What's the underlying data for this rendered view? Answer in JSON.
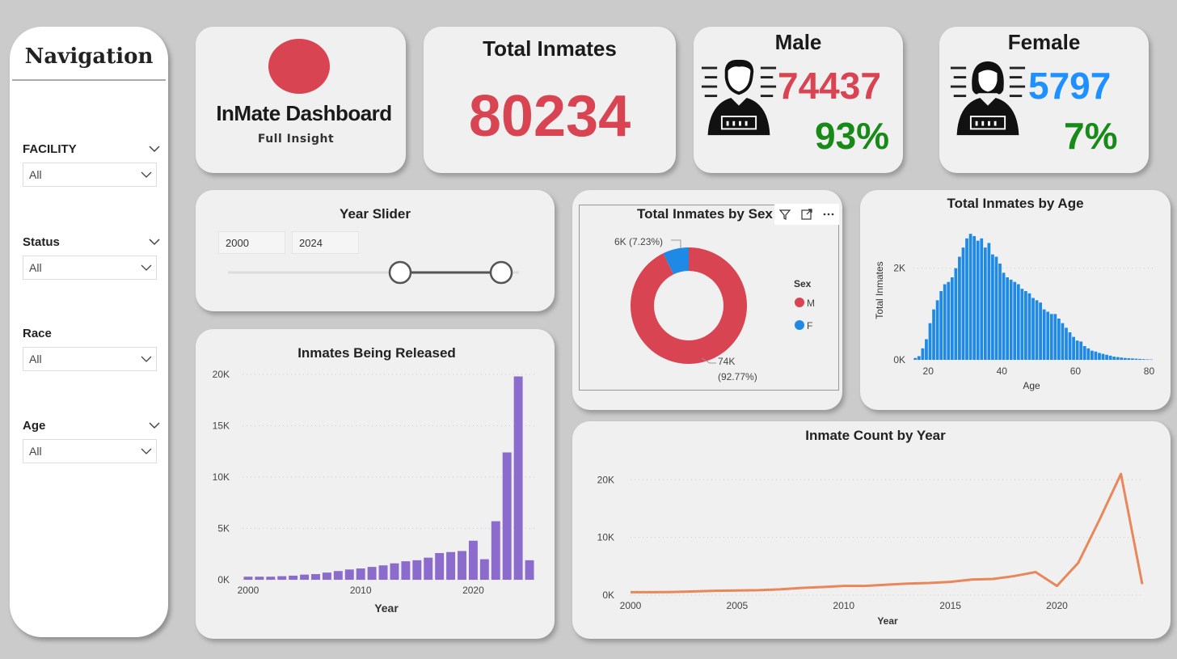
{
  "navigation": {
    "title": "Navigation",
    "filters": [
      {
        "label": "FACILITY",
        "value": "All"
      },
      {
        "label": "Status",
        "value": "All"
      },
      {
        "label": "Race",
        "value": "All"
      },
      {
        "label": "Age",
        "value": "All"
      }
    ]
  },
  "header": {
    "title": "InMate Dashboard",
    "subtitle": "Full Insight",
    "logo_color": "#d94452"
  },
  "kpis": {
    "total": {
      "label": "Total Inmates",
      "value": "80234"
    },
    "male": {
      "label": "Male",
      "value": "74437",
      "pct": "93%"
    },
    "female": {
      "label": "Female",
      "value": "5797",
      "pct": "7%"
    }
  },
  "colors": {
    "accent_red": "#d94452",
    "accent_blue": "#1e90ff",
    "pct_green": "#178a17",
    "released_bar": "#8b6bcc",
    "age_bar": "#1e8ae6",
    "line": "#e8875a"
  },
  "year_slider": {
    "title": "Year Slider",
    "start": "2000",
    "end": "2024",
    "start_level": 0.8,
    "end_level": 1.0
  },
  "chart_data": [
    {
      "id": "released",
      "type": "bar",
      "title": "Inmates Being Released",
      "xlabel": "Year",
      "ylabel": "",
      "ylim": [
        0,
        20000
      ],
      "yticks": [
        "0K",
        "5K",
        "10K",
        "15K",
        "20K"
      ],
      "xticks": [
        "2000",
        "2010",
        "2020"
      ],
      "categories": [
        2000,
        2001,
        2002,
        2003,
        2004,
        2005,
        2006,
        2007,
        2008,
        2009,
        2010,
        2011,
        2012,
        2013,
        2014,
        2015,
        2016,
        2017,
        2018,
        2019,
        2020,
        2021,
        2022,
        2023,
        2024
      ],
      "values": [
        300,
        300,
        300,
        350,
        400,
        500,
        550,
        700,
        850,
        1000,
        1100,
        1250,
        1400,
        1600,
        1800,
        1900,
        2150,
        2600,
        2700,
        2800,
        3800,
        2000,
        5700,
        12400,
        19800,
        1900
      ]
    },
    {
      "id": "by_sex",
      "type": "pie",
      "title": "Total Inmates by Sex",
      "legend_title": "Sex",
      "legend_position": "right",
      "slices": [
        {
          "name": "M",
          "value": 74437,
          "label": "74K",
          "pct_label": "(92.77%)",
          "color": "#d94452"
        },
        {
          "name": "F",
          "value": 5797,
          "label": "6K (7.23%)",
          "pct_label": "",
          "color": "#1e8ae6"
        }
      ]
    },
    {
      "id": "by_age",
      "type": "bar",
      "title": "Total Inmates by Age",
      "xlabel": "Age",
      "ylabel": "Total Inmates",
      "ylim": [
        0,
        3000
      ],
      "yticks": [
        "0K",
        "2K"
      ],
      "xticks": [
        "20",
        "40",
        "60",
        "80"
      ],
      "x_start": 16,
      "values": [
        40,
        80,
        250,
        450,
        800,
        1100,
        1300,
        1500,
        1650,
        1700,
        1800,
        2000,
        2250,
        2450,
        2650,
        2750,
        2700,
        2600,
        2650,
        2450,
        2550,
        2300,
        2250,
        2100,
        1900,
        1800,
        1750,
        1700,
        1650,
        1550,
        1500,
        1450,
        1350,
        1300,
        1250,
        1100,
        1050,
        1000,
        1000,
        900,
        800,
        700,
        600,
        500,
        420,
        400,
        300,
        250,
        200,
        180,
        150,
        130,
        110,
        90,
        70,
        60,
        50,
        40,
        35,
        30,
        25,
        20,
        15,
        10,
        8
      ]
    },
    {
      "id": "by_year",
      "type": "line",
      "title": "Inmate Count by Year",
      "xlabel": "Year",
      "ylabel": "",
      "ylim": [
        0,
        22000
      ],
      "yticks": [
        "0K",
        "10K",
        "20K"
      ],
      "xticks": [
        "2000",
        "2005",
        "2010",
        "2015",
        "2020"
      ],
      "x": [
        2000,
        2001,
        2002,
        2003,
        2004,
        2005,
        2006,
        2007,
        2008,
        2009,
        2010,
        2011,
        2012,
        2013,
        2014,
        2015,
        2016,
        2017,
        2018,
        2019,
        2020,
        2021,
        2022,
        2023,
        2024
      ],
      "values": [
        500,
        500,
        550,
        650,
        750,
        800,
        850,
        1000,
        1250,
        1400,
        1600,
        1600,
        1800,
        2000,
        2100,
        2300,
        2700,
        2800,
        3300,
        4000,
        1600,
        5600,
        13100,
        21000,
        1900
      ]
    }
  ]
}
